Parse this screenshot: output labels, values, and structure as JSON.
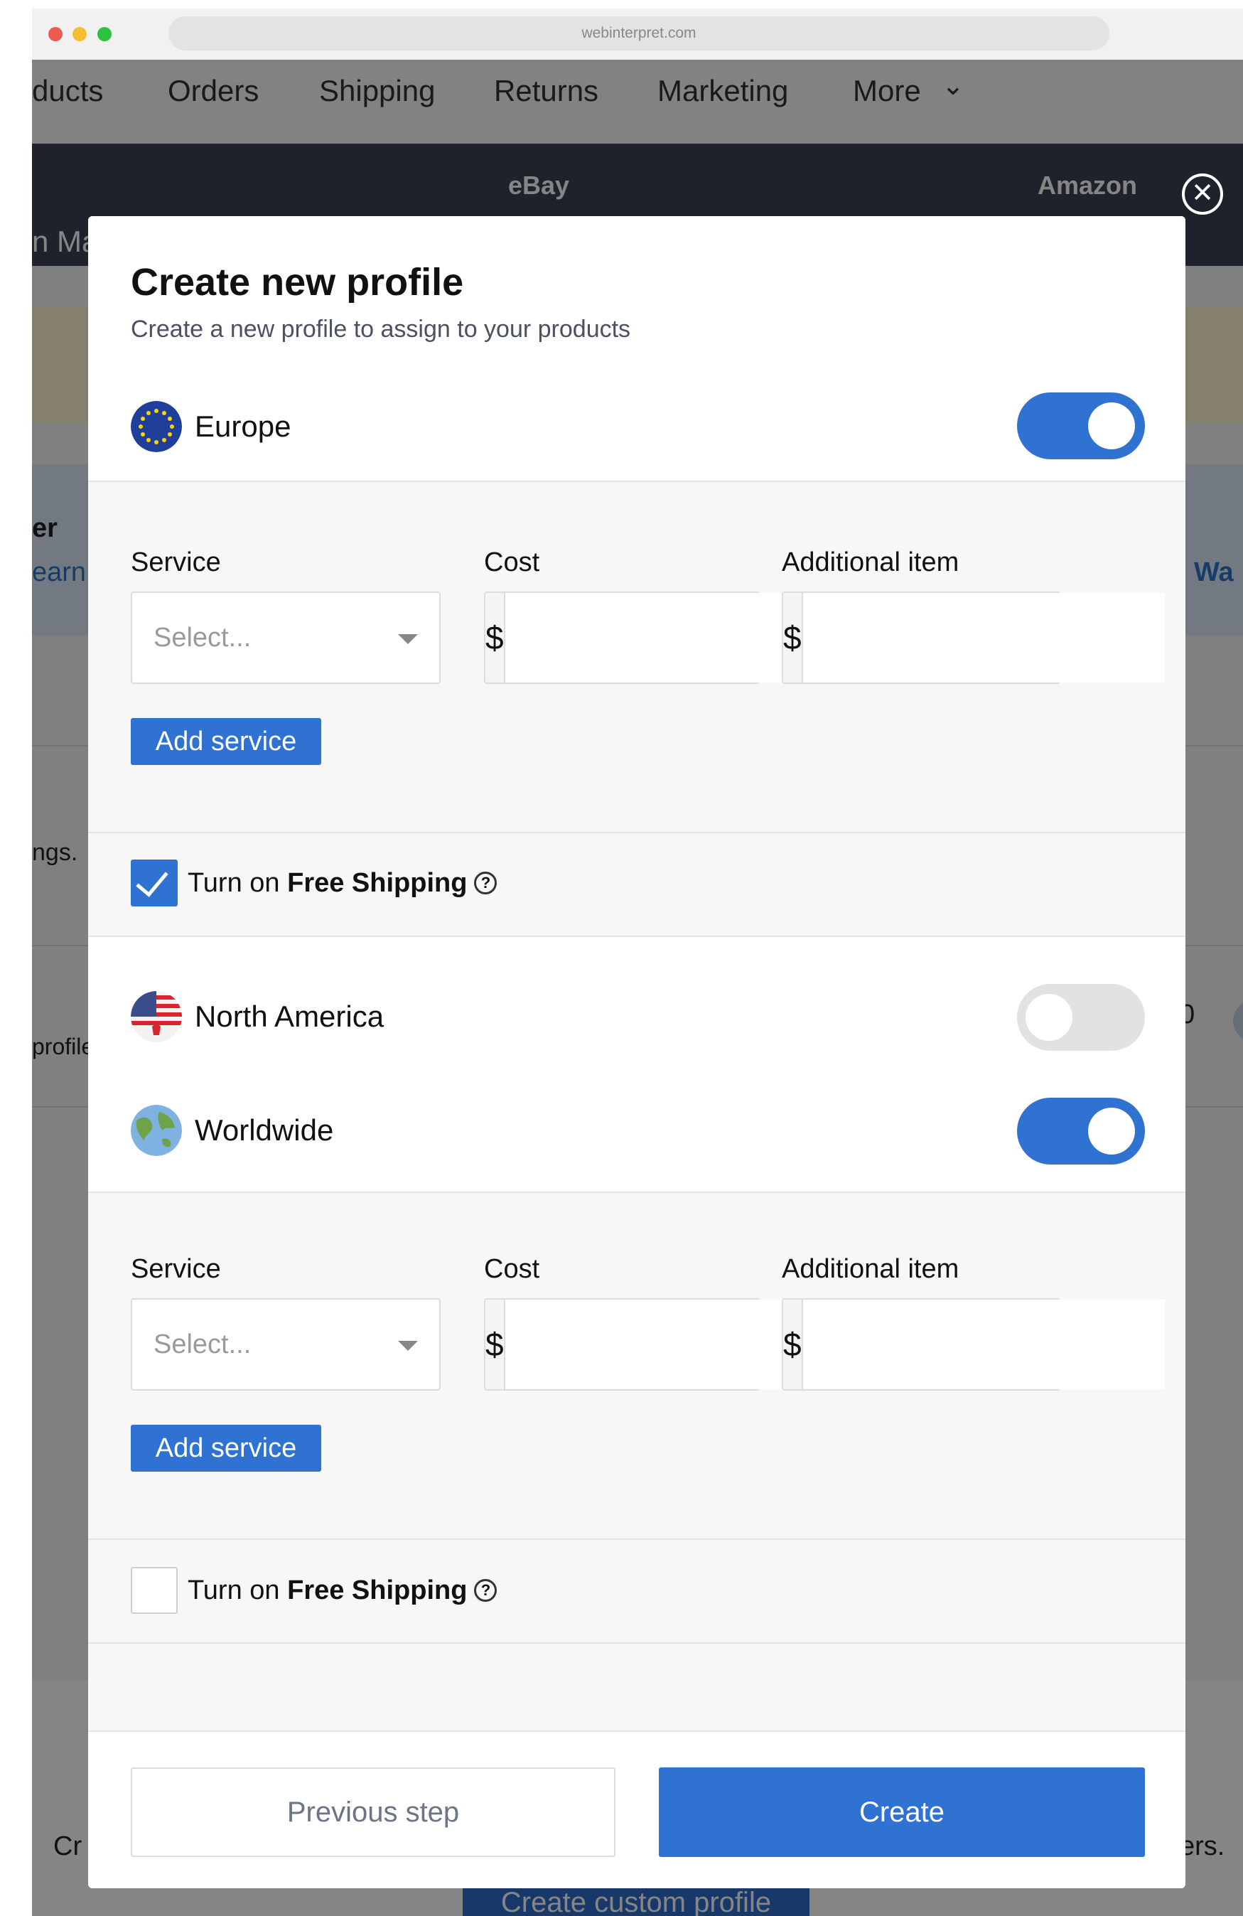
{
  "browser": {
    "url": "webinterpret.com"
  },
  "background": {
    "nav": [
      "ducts",
      "Orders",
      "Shipping",
      "Returns",
      "Marketing",
      "More"
    ],
    "tabs": [
      "eBay",
      "Amazon"
    ],
    "sub_left": "n Ma",
    "left_fragments": [
      "er",
      "earn",
      "ngs.",
      "profile",
      "Cr"
    ],
    "right_fragments": [
      "Wa",
      "0",
      "ers."
    ],
    "bottom_button": "Create custom profile"
  },
  "modal": {
    "title": "Create new profile",
    "subtitle": "Create a new profile to assign to your products",
    "regions": [
      {
        "label": "Europe",
        "enabled": true
      },
      {
        "label": "North America",
        "enabled": false
      },
      {
        "label": "Worldwide",
        "enabled": true
      }
    ],
    "service_blocks": [
      {
        "service_label": "Service",
        "service_placeholder": "Select...",
        "cost_label": "Cost",
        "cost_currency": "$",
        "additional_label": "Additional item",
        "additional_currency": "$",
        "add_button": "Add service",
        "free_shipping_prefix": "Turn on ",
        "free_shipping_bold": "Free Shipping",
        "free_shipping_checked": true
      },
      {
        "service_label": "Service",
        "service_placeholder": "Select...",
        "cost_label": "Cost",
        "cost_currency": "$",
        "additional_label": "Additional item",
        "additional_currency": "$",
        "add_button": "Add service",
        "free_shipping_prefix": "Turn on ",
        "free_shipping_bold": "Free Shipping",
        "free_shipping_checked": false
      }
    ],
    "help_glyph": "?",
    "close_glyph": "✕",
    "footer": {
      "previous": "Previous step",
      "create": "Create"
    }
  },
  "colors": {
    "accent": "#2f72d2",
    "toggle_off": "#e2e2e2",
    "dark_bar": "#3a4252"
  }
}
